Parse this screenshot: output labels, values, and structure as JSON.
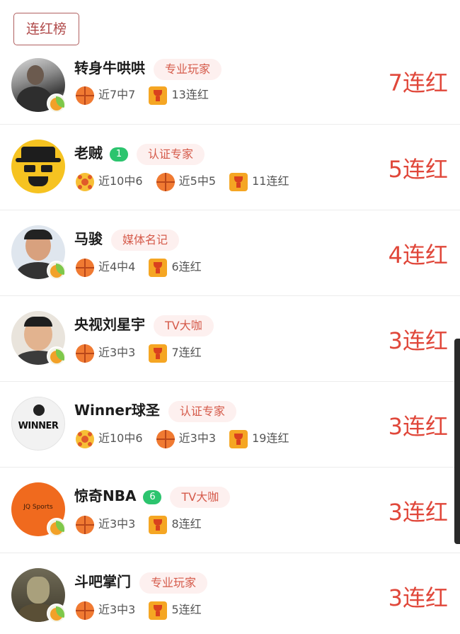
{
  "header": {
    "button_label": "连红榜"
  },
  "rows": [
    {
      "name": "转身牛哄哄",
      "level": "",
      "tag": "专业玩家",
      "stats": [
        {
          "icon": "basketball-icon",
          "text": "近7中7"
        },
        {
          "icon": "trophy-icon",
          "text": "13连红"
        }
      ],
      "streak": "7连红",
      "avatar": "person-driving"
    },
    {
      "name": "老贼",
      "level": "1",
      "tag": "认证专家",
      "stats": [
        {
          "icon": "soccer-ball-icon",
          "text": "近10中6"
        },
        {
          "icon": "basketball-icon",
          "text": "近5中5"
        },
        {
          "icon": "trophy-icon",
          "text": "11连红"
        }
      ],
      "streak": "5连红",
      "avatar": "heisenberg-cartoon"
    },
    {
      "name": "马骏",
      "level": "",
      "tag": "媒体名记",
      "stats": [
        {
          "icon": "basketball-icon",
          "text": "近4中4"
        },
        {
          "icon": "trophy-icon",
          "text": "6连红"
        }
      ],
      "streak": "4连红",
      "avatar": "man-glasses"
    },
    {
      "name": "央视刘星宇",
      "level": "",
      "tag": "TV大咖",
      "stats": [
        {
          "icon": "basketball-icon",
          "text": "近3中3"
        },
        {
          "icon": "trophy-icon",
          "text": "7连红"
        }
      ],
      "streak": "3连红",
      "avatar": "man-portrait"
    },
    {
      "name": "Winner球圣",
      "level": "",
      "tag": "认证专家",
      "stats": [
        {
          "icon": "soccer-ball-icon",
          "text": "近10中6"
        },
        {
          "icon": "basketball-icon",
          "text": "近3中3"
        },
        {
          "icon": "trophy-icon",
          "text": "19连红"
        }
      ],
      "streak": "3连红",
      "avatar": "winner-logo",
      "avatar_text": "WINNER"
    },
    {
      "name": "惊奇NBA",
      "level": "6",
      "tag": "TV大咖",
      "stats": [
        {
          "icon": "basketball-icon",
          "text": "近3中3"
        },
        {
          "icon": "trophy-icon",
          "text": "8连红"
        }
      ],
      "streak": "3连红",
      "avatar": "jq-sports-logo",
      "avatar_text": "JQ Sports"
    },
    {
      "name": "斗吧掌门",
      "level": "",
      "tag": "专业玩家",
      "stats": [
        {
          "icon": "basketball-icon",
          "text": "近3中3"
        },
        {
          "icon": "trophy-icon",
          "text": "5连红"
        }
      ],
      "streak": "3连红",
      "avatar": "puppet-figure"
    }
  ],
  "colors": {
    "accent_red": "#e0473a",
    "tag_bg": "#fdf0ef",
    "level_green": "#2cc46e"
  }
}
